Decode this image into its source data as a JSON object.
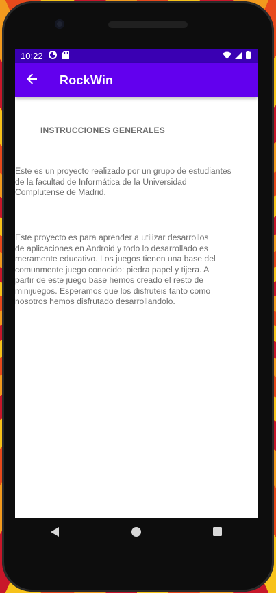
{
  "status_bar": {
    "time": "10:22",
    "left_icons": [
      "data-saver-icon",
      "sd-card-icon"
    ],
    "right_icons": [
      "wifi-icon",
      "signal-icon",
      "battery-icon"
    ]
  },
  "app_bar": {
    "title": "RockWin",
    "back_icon": "arrow-back-icon",
    "color": "#6200ee",
    "status_color": "#3a00b3"
  },
  "content": {
    "heading": "INSTRUCCIONES GENERALES",
    "paragraph_1_lines": [
      "Este es un proyecto realizado por un grupo de estudiantes",
      "de la facultad de Informática de la Universidad",
      "Complutense de Madrid."
    ],
    "paragraph_2_lines": [
      "Este proyecto es para aprender a utilizar desarrollos",
      "de aplicaciones en Android y todo lo desarrollado es",
      "meramente educativo. Los juegos tienen una base del",
      "comunmente juego conocido: piedra papel y tijera. A",
      "partir de este juego base hemos creado el resto de",
      "minijuegos. Esperamos que los disfruteis tanto como",
      "nosotros hemos disfrutado desarrollandolo."
    ]
  },
  "nav_bar": {
    "buttons": [
      "back-triangle-icon",
      "home-circle-icon",
      "recents-square-icon"
    ]
  }
}
